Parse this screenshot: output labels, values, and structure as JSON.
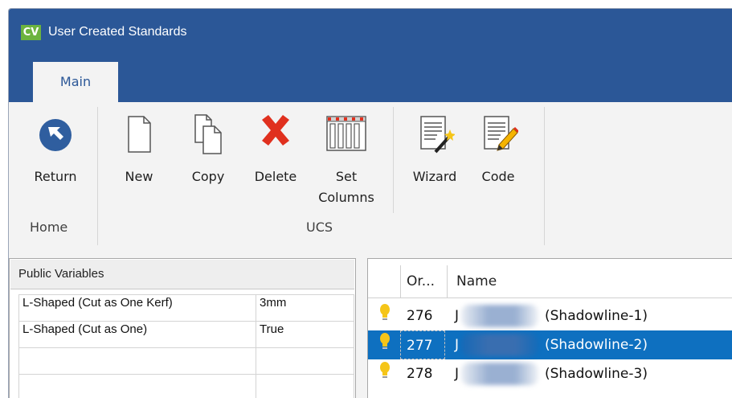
{
  "window": {
    "logo": "CV",
    "title": "User Created Standards"
  },
  "tabs": [
    {
      "label": "Main"
    }
  ],
  "ribbon": {
    "buttons": {
      "return": "Return",
      "new": "New",
      "copy": "Copy",
      "delete": "Delete",
      "set_columns_1": "Set",
      "set_columns_2": "Columns",
      "wizard": "Wizard",
      "code": "Code"
    },
    "groups": {
      "home": "Home",
      "ucs": "UCS"
    }
  },
  "public_variables": {
    "header": "Public Variables",
    "rows": [
      {
        "key": "L-Shaped (Cut as One Kerf)",
        "value": "3mm"
      },
      {
        "key": "L-Shaped (Cut as One)",
        "value": "True"
      },
      {
        "key": "",
        "value": ""
      },
      {
        "key": "",
        "value": ""
      }
    ]
  },
  "grid": {
    "columns": {
      "order": "Or...",
      "name": "Name"
    },
    "rows": [
      {
        "order": "276",
        "prefix": "J",
        "name": "(Shadowline-1)",
        "selected": false
      },
      {
        "order": "277",
        "prefix": "J",
        "name": "(Shadowline-2)",
        "selected": true
      },
      {
        "order": "278",
        "prefix": "J",
        "name": "(Shadowline-3)",
        "selected": false
      }
    ]
  },
  "colors": {
    "titlebar": "#2b5797",
    "accent": "#0e70c0",
    "delete": "#e0301e",
    "bulb": "#f5c518"
  }
}
